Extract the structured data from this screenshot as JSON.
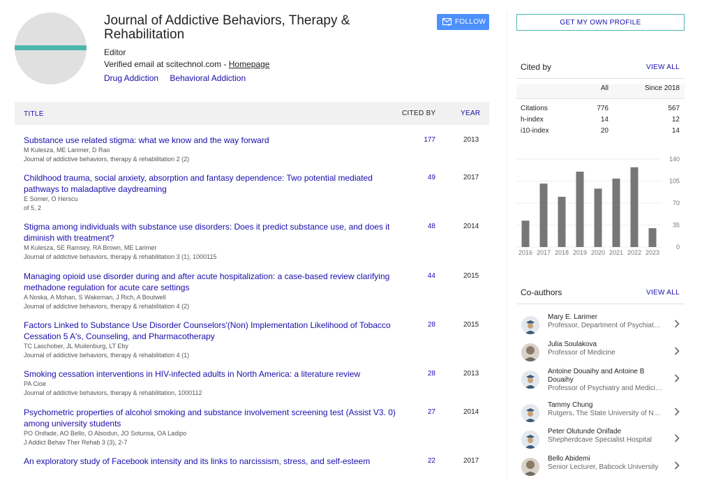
{
  "profile": {
    "name": "Journal of Addictive Behaviors, Therapy & Rehabilitation",
    "affiliation": "Editor",
    "email_text": "Verified email at scitechnol.com - ",
    "homepage_label": "Homepage",
    "interests": [
      "Drug Addiction",
      "Behavioral Addiction"
    ],
    "follow_label": "FOLLOW"
  },
  "table": {
    "col_title": "TITLE",
    "col_cited": "CITED BY",
    "col_year": "YEAR",
    "rows": [
      {
        "title": "Substance use related stigma: what we know and the way forward",
        "authors": "M Kulesza, ME Larimer, D Rao",
        "venue": "Journal of addictive behaviors, therapy & rehabilitation 2 (2)",
        "cites": "177",
        "year": "2013"
      },
      {
        "title": "Childhood trauma, social anxiety, absorption and fantasy dependence: Two potential mediated pathways to maladaptive daydreaming",
        "authors": "E Somer, O Herscu",
        "venue": "of 5, 2",
        "cites": "49",
        "year": "2017"
      },
      {
        "title": "Stigma among individuals with substance use disorders: Does it predict substance use, and does it diminish with treatment?",
        "authors": "M Kulesza, SE Ramsey, RA Brown, ME Larimer",
        "venue": "Journal of addictive behaviors, therapy & rehabilitation 3 (1), 1000115",
        "cites": "48",
        "year": "2014"
      },
      {
        "title": "Managing opioid use disorder during and after acute hospitalization: a case-based review clarifying methadone regulation for acute care settings",
        "authors": "A Noska, A Mohan, S Wakeman, J Rich, A Boutwell",
        "venue": "Journal of addictive behaviors, therapy & rehabilitation 4 (2)",
        "cites": "44",
        "year": "2015"
      },
      {
        "title": "Factors Linked to Substance Use Disorder Counselors'(Non) Implementation Likelihood of Tobacco Cessation 5 A's, Counseling, and Pharmacotherapy",
        "authors": "TC Laschober, JL Muilenburg, LT Eby",
        "venue": "Journal of addictive behaviors, therapy & rehabilitation 4 (1)",
        "cites": "28",
        "year": "2015"
      },
      {
        "title": "Smoking cessation interventions in HIV-infected adults in North America: a literature review",
        "authors": "PA Cioe",
        "venue": "Journal of addictive behaviors, therapy & rehabilitation, 1000112",
        "cites": "28",
        "year": "2013"
      },
      {
        "title": "Psychometric properties of alcohol smoking and substance involvement screening test (Assist V3. 0) among university students",
        "authors": "PO Onifade, AO Bello, O Abiodun, JO Sotunsa, OA Ladipo",
        "venue": "J Addict Behav Ther Rehab 3 (3), 2-7",
        "cites": "27",
        "year": "2014"
      },
      {
        "title": "An exploratory study of Facebook intensity and its links to narcissism, stress, and self-esteem",
        "authors": "",
        "venue": "",
        "cites": "22",
        "year": "2017"
      }
    ]
  },
  "sidebar": {
    "profile_btn": "GET MY OWN PROFILE",
    "cited_by_title": "Cited by",
    "view_all": "VIEW ALL",
    "stats_head": [
      "All",
      "Since 2018"
    ],
    "stats": [
      {
        "label": "Citations",
        "all": "776",
        "since": "567"
      },
      {
        "label": "h-index",
        "all": "14",
        "since": "12"
      },
      {
        "label": "i10-index",
        "all": "20",
        "since": "14"
      }
    ],
    "coauthors_title": "Co-authors",
    "coauthors": [
      {
        "name": "Mary E. Larimer",
        "aff": "Professor, Department of Psychiatry and Behavioral Sciences",
        "photo": false
      },
      {
        "name": "Julia Soulakova",
        "aff": "Professor of Medicine",
        "photo": true
      },
      {
        "name": "Antoine Douaihy and Antoine B Douaihy",
        "aff": "Professor of Psychiatry and Medicine",
        "photo": false
      },
      {
        "name": "Tammy Chung",
        "aff": "Rutgers, The State University of New Jersey",
        "photo": false
      },
      {
        "name": "Peter Olutunde Onifade",
        "aff": "Shepherdcave Specialist Hospital",
        "photo": false
      },
      {
        "name": "Bello Abidemi",
        "aff": "Senior Lecturer, Babcock University",
        "photo": true
      }
    ]
  },
  "colors": {
    "link": "#1a0dab",
    "accent": "#4d90fe",
    "teal": "#4db6ac",
    "bar": "#777777"
  },
  "chart_data": {
    "type": "bar",
    "categories": [
      "2016",
      "2017",
      "2018",
      "2019",
      "2020",
      "2021",
      "2022",
      "2023"
    ],
    "values": [
      42,
      101,
      80,
      120,
      93,
      109,
      127,
      30
    ],
    "ylim": [
      0,
      140
    ],
    "yticks": [
      "0",
      "35",
      "70",
      "105",
      "140"
    ],
    "grid": true
  }
}
